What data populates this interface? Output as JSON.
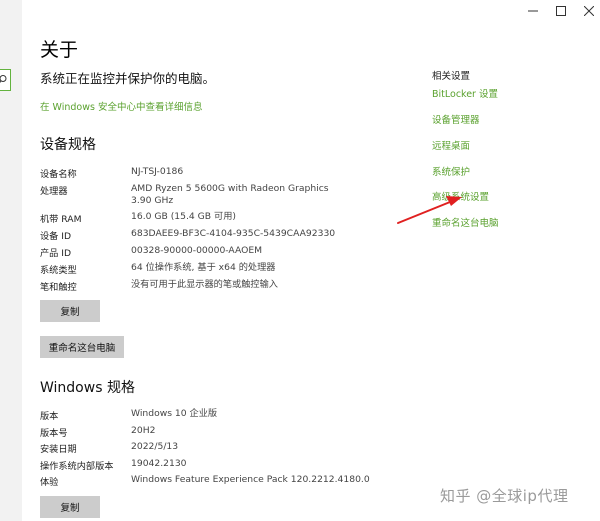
{
  "window": {
    "controls": {
      "minimize_icon": "minimize-icon",
      "maximize_icon": "maximize-icon",
      "close_icon": "close-icon"
    }
  },
  "page": {
    "title": "关于",
    "protect_text": "系统正在监控并保护你的电脑。",
    "security_link": "在 Windows 安全中心中查看详细信息"
  },
  "device_specs": {
    "title": "设备规格",
    "rows": [
      {
        "label": "设备名称",
        "value": "NJ-TSJ-0186"
      },
      {
        "label": "处理器",
        "value": "AMD Ryzen 5 5600G with Radeon Graphics",
        "value2": "3.90 GHz"
      },
      {
        "label": "机带 RAM",
        "value": "16.0 GB (15.4 GB 可用)"
      },
      {
        "label": "设备 ID",
        "value": "683DAEE9-BF3C-4104-935C-5439CAA92330"
      },
      {
        "label": "产品 ID",
        "value": "00328-90000-00000-AAOEM"
      },
      {
        "label": "系统类型",
        "value": "64 位操作系统, 基于 x64 的处理器"
      },
      {
        "label": "笔和触控",
        "value": "没有可用于此显示器的笔或触控输入"
      }
    ],
    "copy_button": "复制",
    "rename_button": "重命名这台电脑"
  },
  "windows_specs": {
    "title": "Windows 规格",
    "rows": [
      {
        "label": "版本",
        "value": "Windows 10 企业版"
      },
      {
        "label": "版本号",
        "value": "20H2"
      },
      {
        "label": "安装日期",
        "value": "2022/5/13"
      },
      {
        "label": "操作系统内部版本",
        "value": "19042.2130"
      },
      {
        "label": "体验",
        "value": "Windows Feature Experience Pack 120.2212.4180.0"
      }
    ],
    "copy_button": "复制"
  },
  "related": {
    "title": "相关设置",
    "links": [
      "BitLocker 设置",
      "设备管理器",
      "远程桌面",
      "系统保护",
      "高级系统设置",
      "重命名这台电脑"
    ]
  },
  "annotation": {
    "arrow_color": "#e02020"
  },
  "watermark": "知乎 @全球ip代理",
  "colors": {
    "link": "#5aa12e",
    "button": "#cccccc",
    "sidebar": "#f2f2f2"
  }
}
